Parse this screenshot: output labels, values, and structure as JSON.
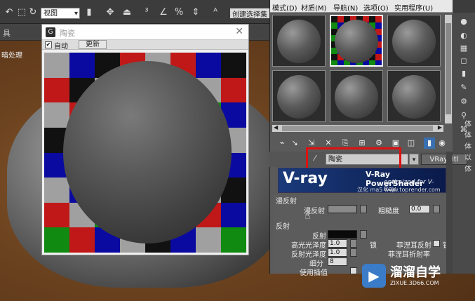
{
  "toolbar": {
    "view_select": "视图",
    "text_fragment": "创建选择集"
  },
  "menu_strip": {
    "item1": "具"
  },
  "side_label": "暗处理",
  "bracket": "]",
  "preview": {
    "title": "陶瓷",
    "auto_label": "自动",
    "update_label": "更新"
  },
  "mated": {
    "menu": [
      "模式(D)",
      "材质(M)",
      "导航(N)",
      "选项(O)",
      "实用程序(U)"
    ],
    "name": "陶瓷",
    "type": "VRayMtl"
  },
  "banner": {
    "vray": "V-ray",
    "powershader": "V-Ray PowerShader",
    "optimized": "optimized for V-Ray",
    "credit": "汉化  ma5  www.toprender.com"
  },
  "params": {
    "diffuse_group": "漫反射",
    "diffuse_label": "漫反射",
    "roughness_label": "粗糙度",
    "roughness_value": "0.0",
    "reflection_group": "反射",
    "reflect_label": "反射",
    "hilight_gloss_label": "高光光泽度",
    "hilight_gloss_value": "1.0",
    "lock_label": "锁",
    "fresnel_label": "菲涅耳反射",
    "fresnel_lock": "锁",
    "refl_gloss_label": "反射光泽度",
    "refl_gloss_value": "1.0",
    "fresnel_ior_label": "菲涅耳折射率",
    "subdivs_label": "细分",
    "subdivs_value": "8",
    "use_interp_label": "使用插值"
  },
  "watermark": {
    "name": "溜溜自学",
    "url": "ZIXUE.3D66.COM"
  },
  "right_edge": [
    "体",
    "体",
    "体",
    "以",
    "体"
  ],
  "colors": {
    "checker_red": "#c01818",
    "checker_blue": "#0a0aa0",
    "checker_green": "#108a10",
    "checker_gray": "#a0a0a0",
    "checker_black": "#111111",
    "highlight": "#e01010",
    "brand_blue": "#3a7cc8"
  },
  "checker_pattern": [
    [
      "gray",
      "blue",
      "black",
      "red",
      "gray",
      "red",
      "blue",
      "black"
    ],
    [
      "red",
      "black",
      "gray",
      "blue",
      "green",
      "black",
      "gray",
      "red"
    ],
    [
      "gray",
      "red",
      "blue",
      "green",
      "black",
      "blue",
      "green",
      "blue"
    ],
    [
      "black",
      "gray",
      "red",
      "black",
      "gray",
      "green",
      "red",
      "gray"
    ],
    [
      "blue",
      "green",
      "black",
      "gray",
      "red",
      "gray",
      "black",
      "blue"
    ],
    [
      "gray",
      "blue",
      "gray",
      "black",
      "blue",
      "red",
      "gray",
      "black"
    ],
    [
      "red",
      "gray",
      "green",
      "blue",
      "gray",
      "black",
      "red",
      "blue"
    ],
    [
      "green",
      "red",
      "blue",
      "gray",
      "black",
      "blue",
      "gray",
      "green"
    ]
  ]
}
